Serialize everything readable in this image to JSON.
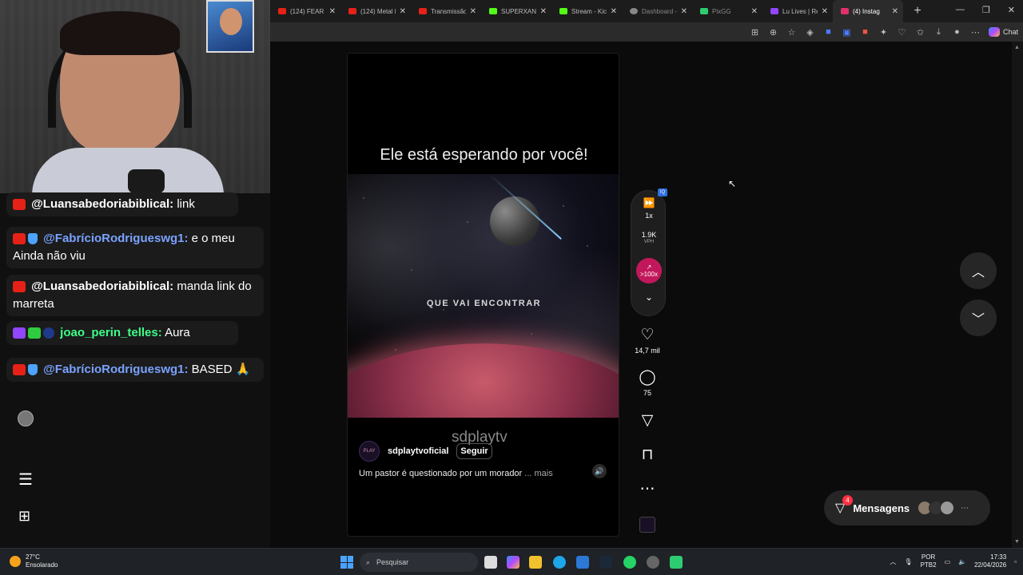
{
  "browser": {
    "tabs": [
      {
        "label": "(124) FEAR TH",
        "color": "#e62117"
      },
      {
        "label": "(124) Metal In",
        "color": "#e62117"
      },
      {
        "label": "Transmissão a",
        "color": "#e62117"
      },
      {
        "label": "SUPERXANDA",
        "color": "#53fc18"
      },
      {
        "label": "Stream - Kick",
        "color": "#53fc18"
      },
      {
        "label": "Dashboard -",
        "color": "#888888"
      },
      {
        "label": "PixGG",
        "color": "#2ecc71"
      },
      {
        "label": "Lu Lives | Re",
        "color": "#9146ff"
      },
      {
        "label": "(4) Instag",
        "color": "#e1306c",
        "active": true
      }
    ],
    "new_tab": "+",
    "copilot_label": "Chat"
  },
  "reel": {
    "headline": "Ele está esperando por você!",
    "overlay_text": "QUE VAI ENCONTRAR",
    "watermark": "sdplaytv",
    "account": "sdplaytvoficial",
    "avatar_text": "PLAY",
    "follow": "Seguir",
    "caption": "Um pastor é questionado por um morador",
    "more": "... mais"
  },
  "speed_panel": {
    "badge": "IQ",
    "rate": "1x",
    "vph_value": "1.9K",
    "vph_label": "VPH",
    "trend": ">100x"
  },
  "actions": {
    "likes": "14,7 mil",
    "comments": "75"
  },
  "messages": {
    "label": "Mensagens",
    "badge": "4"
  },
  "chat": [
    {
      "user": "@Luansabedoriabiblical:",
      "text": "link",
      "style": "red"
    },
    {
      "user": "@FabrícioRodrigueswg1:",
      "text": "e o meu Ainda não viu",
      "style": "blue"
    },
    {
      "user": "@Luansabedoriabiblical:",
      "text": "manda link do marreta",
      "style": "red"
    },
    {
      "user": "joao_perin_telles:",
      "text": "Aura",
      "style": "green"
    },
    {
      "user": "@FabrícioRodrigueswg1:",
      "text": "BASED 🙏",
      "style": "blue"
    }
  ],
  "taskbar": {
    "temp": "27°C",
    "weather": "Ensolarado",
    "search": "Pesquisar",
    "lang1": "POR",
    "lang2": "PTB2",
    "time": "17:33",
    "date": "22/04/2026"
  }
}
